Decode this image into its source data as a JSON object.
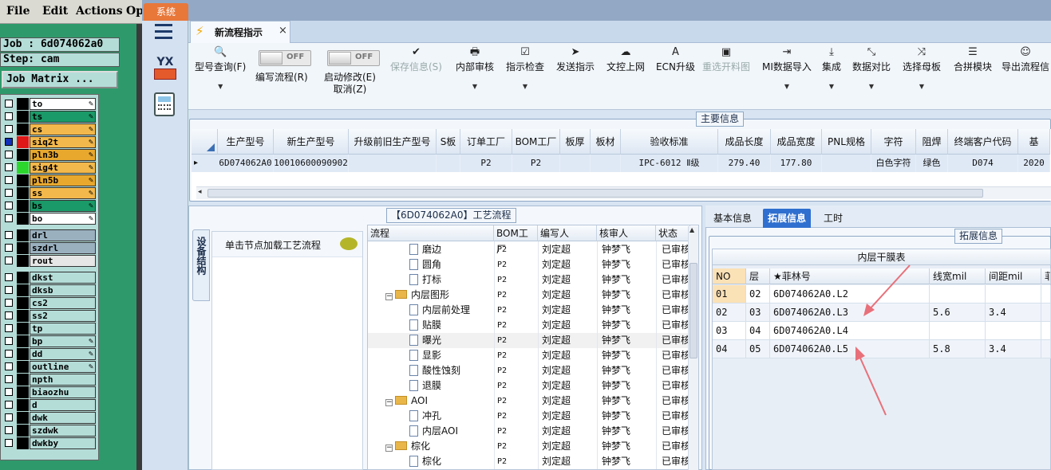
{
  "left_app": {
    "menu": [
      "File",
      "Edit",
      "Actions",
      "Op"
    ],
    "job_label": "Job : 6d074062a0",
    "step_label": "Step: cam",
    "job_matrix_button": "Job Matrix ...",
    "layers_group1": [
      {
        "name": "to",
        "color": "#ffffff",
        "sw": "#000000",
        "edit": true
      },
      {
        "name": "ts",
        "color": "#1a9a68",
        "sw": "#000000",
        "edit": true
      },
      {
        "name": "cs",
        "color": "#f3b84b",
        "sw": "#000000",
        "edit": true
      },
      {
        "name": "siq2t",
        "color": "#f3b84b",
        "sw": "#e01818",
        "edit": true,
        "check_blue": true
      },
      {
        "name": "pln3b",
        "color": "#e8a82e",
        "sw": "#000000",
        "edit": true
      },
      {
        "name": "sig4t",
        "color": "#f3b84b",
        "sw": "#2dd62d",
        "edit": true
      },
      {
        "name": "pln5b",
        "color": "#e8a82e",
        "sw": "#000000",
        "edit": true
      },
      {
        "name": "ss",
        "color": "#f3b84b",
        "sw": "#000000",
        "edit": true
      },
      {
        "name": "bs",
        "color": "#1a9a68",
        "sw": "#000000",
        "edit": true
      },
      {
        "name": "bo",
        "color": "#ffffff",
        "sw": "#000000",
        "edit": true
      }
    ],
    "layers_group2": [
      {
        "name": "drl",
        "color": "#9ab0bf",
        "sw": "#000000"
      },
      {
        "name": "szdrl",
        "color": "#9ab0bf",
        "sw": "#000000"
      },
      {
        "name": "rout",
        "color": "#e6e6e6",
        "sw": "#000000"
      }
    ],
    "layers_group3": [
      {
        "name": "dkst",
        "color": "#b4ddd8",
        "sw": "#000000"
      },
      {
        "name": "dksb",
        "color": "#b4ddd8",
        "sw": "#000000"
      },
      {
        "name": "cs2",
        "color": "#b4ddd8",
        "sw": "#000000"
      },
      {
        "name": "ss2",
        "color": "#b4ddd8",
        "sw": "#000000"
      },
      {
        "name": "tp",
        "color": "#b4ddd8",
        "sw": "#000000"
      },
      {
        "name": "bp",
        "color": "#b4ddd8",
        "sw": "#000000",
        "edit": true
      },
      {
        "name": "dd",
        "color": "#b4ddd8",
        "sw": "#000000",
        "edit": true
      },
      {
        "name": "outline",
        "color": "#b4ddd8",
        "sw": "#000000",
        "edit": true
      },
      {
        "name": "npth",
        "color": "#b4ddd8",
        "sw": "#000000"
      },
      {
        "name": "biaozhu",
        "color": "#b4ddd8",
        "sw": "#000000"
      },
      {
        "name": "d",
        "color": "#b4ddd8",
        "sw": "#000000"
      },
      {
        "name": "dwk",
        "color": "#b4ddd8",
        "sw": "#000000"
      },
      {
        "name": "szdwk",
        "color": "#b4ddd8",
        "sw": "#000000"
      },
      {
        "name": "dwkby",
        "color": "#b4ddd8",
        "sw": "#000000"
      }
    ]
  },
  "app": {
    "system_tab": "系统",
    "doc_tab": "新流程指示",
    "close_glyph": "×",
    "sidebar_logo": "YX"
  },
  "toolbar": {
    "items": [
      {
        "label": "型号查询(F)",
        "icon": "🔍",
        "dropdown": true
      },
      {
        "label": "编写流程(R)",
        "toggle": "OFF"
      },
      {
        "label": "启动修改(E)\n取消(Z)",
        "toggle": "OFF"
      },
      {
        "label": "保存信息(S)",
        "icon": "✔",
        "disabled": true
      },
      {
        "label": "内部审核",
        "icon": "🖶",
        "dropdown": true
      },
      {
        "label": "指示检查",
        "icon": "☑",
        "dropdown": true
      },
      {
        "label": "发送指示",
        "icon": "➤"
      },
      {
        "label": "文控上网",
        "icon": "☁"
      },
      {
        "label": "ECN升级",
        "icon": "A"
      },
      {
        "label": "重选开料图",
        "icon": "▣",
        "disabled": true
      },
      {
        "label": "MI数据导入",
        "icon": "⇥",
        "dropdown": true
      },
      {
        "label": "集成",
        "icon": "⤓",
        "dropdown": true
      },
      {
        "label": "数据对比",
        "icon": "⤡",
        "dropdown": true
      },
      {
        "label": "选择母板",
        "icon": "⤨",
        "dropdown": true
      },
      {
        "label": "合拼模块",
        "icon": "☰"
      },
      {
        "label": "导出流程信",
        "icon": "☺"
      }
    ]
  },
  "main_info": {
    "legend": "主要信息",
    "columns": [
      "生产型号",
      "新生产型号",
      "升级前旧生产型号",
      "S板",
      "订单工厂",
      "BOM工厂",
      "板厚",
      "板材",
      "验收标准",
      "成品长度",
      "成品宽度",
      "PNL规格",
      "字符",
      "阻焊",
      "终端客户代码",
      "基"
    ],
    "row": [
      "6D074062A0",
      "10010600090902",
      "",
      "",
      "P2",
      "P2",
      "",
      "",
      "IPC-6012 Ⅱ级",
      "279.40",
      "177.80",
      "",
      "白色字符",
      "绿色",
      "D074",
      "2020"
    ],
    "row_marker": "▸"
  },
  "flow_panel": {
    "title": "【6D074062A0】工艺流程",
    "vertical_tab": "设备结构",
    "left_item": "单击节点加载工艺流程",
    "columns": [
      "流程",
      "BOM工厂",
      "编写人",
      "核审人",
      "状态"
    ],
    "rows": [
      {
        "name": "磨边",
        "level": 2,
        "bom": "P2",
        "writer": "刘定超",
        "reviewer": "钟梦飞",
        "status": "已审核"
      },
      {
        "name": "圆角",
        "level": 2,
        "bom": "P2",
        "writer": "刘定超",
        "reviewer": "钟梦飞",
        "status": "已审核"
      },
      {
        "name": "打标",
        "level": 2,
        "bom": "P2",
        "writer": "刘定超",
        "reviewer": "钟梦飞",
        "status": "已审核"
      },
      {
        "name": "内层图形",
        "level": 1,
        "bom": "P2",
        "writer": "刘定超",
        "reviewer": "钟梦飞",
        "status": "已审核"
      },
      {
        "name": "内层前处理",
        "level": 2,
        "bom": "P2",
        "writer": "刘定超",
        "reviewer": "钟梦飞",
        "status": "已审核"
      },
      {
        "name": "贴膜",
        "level": 2,
        "bom": "P2",
        "writer": "刘定超",
        "reviewer": "钟梦飞",
        "status": "已审核"
      },
      {
        "name": "曝光",
        "level": 2,
        "bom": "P2",
        "writer": "刘定超",
        "reviewer": "钟梦飞",
        "status": "已审核",
        "selected": true
      },
      {
        "name": "显影",
        "level": 2,
        "bom": "P2",
        "writer": "刘定超",
        "reviewer": "钟梦飞",
        "status": "已审核"
      },
      {
        "name": "酸性蚀刻",
        "level": 2,
        "bom": "P2",
        "writer": "刘定超",
        "reviewer": "钟梦飞",
        "status": "已审核"
      },
      {
        "name": "退膜",
        "level": 2,
        "bom": "P2",
        "writer": "刘定超",
        "reviewer": "钟梦飞",
        "status": "已审核"
      },
      {
        "name": "AOI",
        "level": 1,
        "bom": "P2",
        "writer": "刘定超",
        "reviewer": "钟梦飞",
        "status": "已审核"
      },
      {
        "name": "冲孔",
        "level": 2,
        "bom": "P2",
        "writer": "刘定超",
        "reviewer": "钟梦飞",
        "status": "已审核"
      },
      {
        "name": "内层AOI",
        "level": 2,
        "bom": "P2",
        "writer": "刘定超",
        "reviewer": "钟梦飞",
        "status": "已审核"
      },
      {
        "name": "棕化",
        "level": 1,
        "bom": "P2",
        "writer": "刘定超",
        "reviewer": "钟梦飞",
        "status": "已审核"
      },
      {
        "name": "棕化",
        "level": 2,
        "bom": "P2",
        "writer": "刘定超",
        "reviewer": "钟梦飞",
        "status": "已审核"
      }
    ]
  },
  "right_panel": {
    "tabs": [
      "基本信息",
      "拓展信息",
      "工时"
    ],
    "active_tab": 1,
    "legend": "拓展信息",
    "table_title": "内层干膜表",
    "columns": [
      "NO",
      "层",
      "★菲林号",
      "线宽mil",
      "间距mil",
      "菲"
    ],
    "rows": [
      [
        "01",
        "02",
        "6D074062A0.L2",
        "",
        "",
        ""
      ],
      [
        "02",
        "03",
        "6D074062A0.L3",
        "5.6",
        "3.4",
        ""
      ],
      [
        "03",
        "04",
        "6D074062A0.L4",
        "",
        "",
        ""
      ],
      [
        "04",
        "05",
        "6D074062A0.L5",
        "5.8",
        "3.4",
        ""
      ]
    ],
    "annotation_color": "#e8707a"
  }
}
